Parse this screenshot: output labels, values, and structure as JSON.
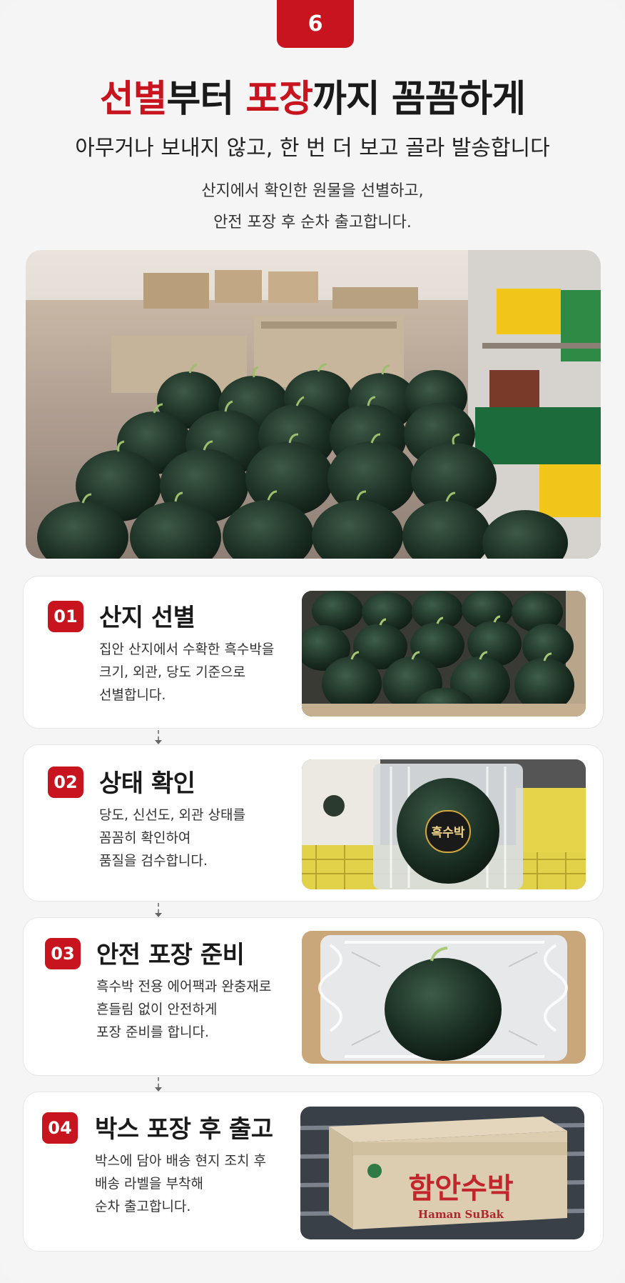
{
  "step_number": "6",
  "headline": {
    "part1": "선별",
    "part2": "부터 ",
    "part3": "포장",
    "part4": "까지 꼼꼼하게"
  },
  "subheadline": "아무거나 보내지 않고, 한 번 더 보고 골라 발송합니다",
  "description": {
    "line1": "산지에서 확인한 원물을 선별하고,",
    "line2": "안전 포장 후 순차 출고합니다."
  },
  "colors": {
    "accent": "#c8141e",
    "background": "#f5f5f5",
    "card": "#ffffff"
  },
  "steps": [
    {
      "number": "01",
      "title": "산지 선별",
      "text": "집안 산지에서 수확한 흑수박을\n크기, 외관, 당도 기준으로\n선별합니다.",
      "photo_icon": "watermelons-in-crate-photo"
    },
    {
      "number": "02",
      "title": "상태 확인",
      "text": "당도, 신선도, 외관 상태를\n꼼꼼히 확인하여\n품질을 검수합니다.",
      "photo_icon": "watermelon-in-air-packaging-photo",
      "photo_label": "흑수박"
    },
    {
      "number": "03",
      "title": "안전 포장 준비",
      "text": "흑수박 전용 에어팩과 완충재로\n흔들림 없이 안전하게\n포장 준비를 합니다.",
      "photo_icon": "watermelon-in-cushion-box-photo"
    },
    {
      "number": "04",
      "title": "박스 포장 후 출고",
      "text": "박스에 담아 배송 현지 조치 후\n배송 라벨을 부착해\n순차 출고합니다.",
      "photo_icon": "shipping-box-photo",
      "box_label_ko": "함안수박",
      "box_label_en": "Haman SuBak"
    }
  ]
}
